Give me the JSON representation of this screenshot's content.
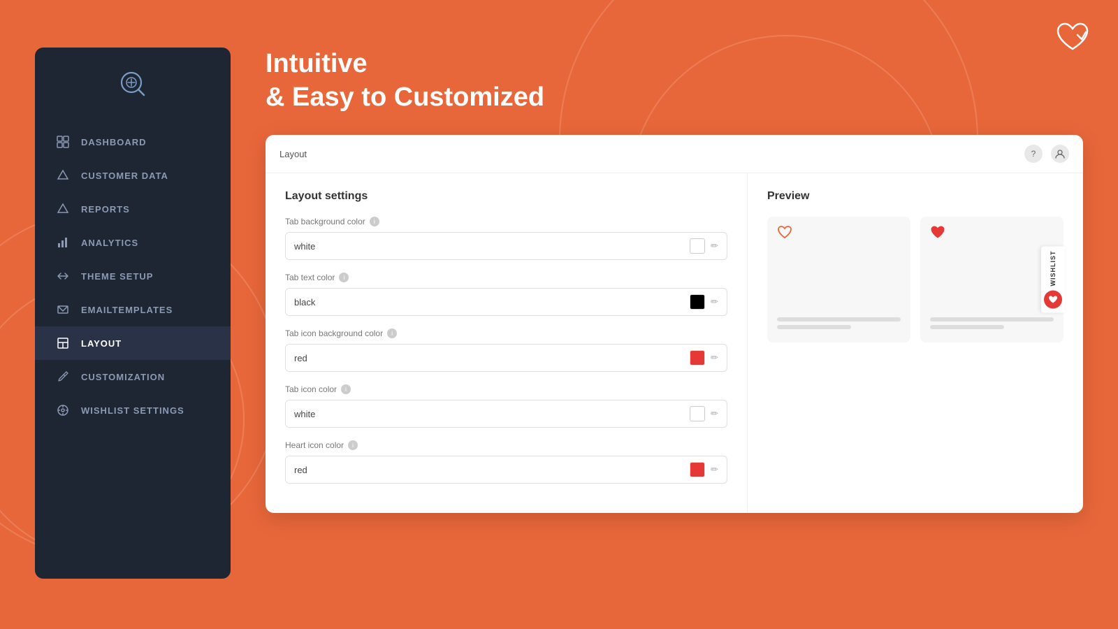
{
  "background_color": "#E8673A",
  "logo": {
    "icon": "♡✓",
    "aria": "App Logo"
  },
  "sidebar": {
    "items": [
      {
        "id": "dashboard",
        "label": "DASHBOARD",
        "icon": "grid"
      },
      {
        "id": "customer-data",
        "label": "CUSTOMER DATA",
        "icon": "triangle-down"
      },
      {
        "id": "reports",
        "label": "REPORTS",
        "icon": "triangle-down"
      },
      {
        "id": "analytics",
        "label": "ANALYTICS",
        "icon": "bar-chart"
      },
      {
        "id": "theme-setup",
        "label": "THEME SETUP",
        "icon": "arrows"
      },
      {
        "id": "email-templates",
        "label": "EMAILTEMPLATES",
        "icon": "envelope"
      },
      {
        "id": "layout",
        "label": "LAYOUT",
        "icon": "image",
        "active": true
      },
      {
        "id": "customization",
        "label": "CUSTOMIZATION",
        "icon": "wrench"
      },
      {
        "id": "wishlist-settings",
        "label": "WISHLIST SETTINGS",
        "icon": "gear"
      }
    ]
  },
  "headline": {
    "line1": "Intuitive",
    "line2": "& Easy to Customized"
  },
  "panel": {
    "title": "Layout",
    "help_icon": "?",
    "user_icon": "👤"
  },
  "layout_settings": {
    "title": "Layout settings",
    "fields": [
      {
        "id": "tab-bg-color",
        "label": "Tab background color",
        "value": "white",
        "swatch_color": "#ffffff",
        "has_swatch": true
      },
      {
        "id": "tab-text-color",
        "label": "Tab text color",
        "value": "black",
        "swatch_color": "#000000",
        "has_swatch": true
      },
      {
        "id": "tab-icon-bg-color",
        "label": "Tab icon background color",
        "value": "red",
        "swatch_color": "#e53935",
        "has_swatch": true
      },
      {
        "id": "tab-icon-color",
        "label": "Tab icon color",
        "value": "white",
        "swatch_color": "#ffffff",
        "has_swatch": true
      },
      {
        "id": "heart-icon-color",
        "label": "Heart icon color",
        "value": "red",
        "swatch_color": "#e53935",
        "has_swatch": true
      }
    ]
  },
  "preview": {
    "title": "Preview",
    "wishlist_label": "WISHLIST"
  }
}
